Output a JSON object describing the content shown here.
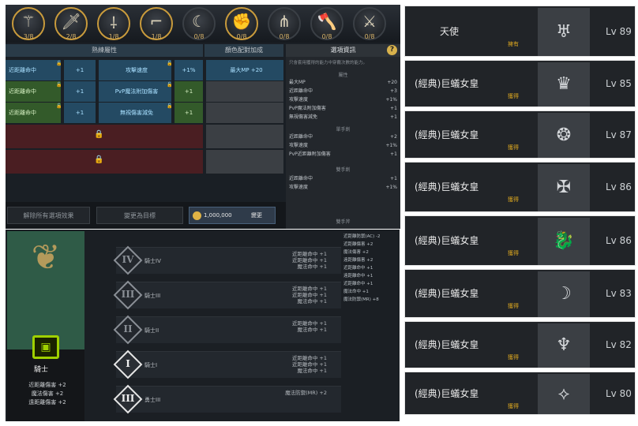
{
  "weapons": [
    {
      "icon": "staff-icon",
      "glyph": "⚚",
      "count": "3/8",
      "active": true
    },
    {
      "icon": "sword-icon",
      "glyph": "🗡",
      "count": "2/8",
      "active": true
    },
    {
      "icon": "spear-icon",
      "glyph": "⸸",
      "count": "1/8",
      "active": true
    },
    {
      "icon": "gun-icon",
      "glyph": "⌐",
      "count": "1/8",
      "active": true
    },
    {
      "icon": "scythe-icon",
      "glyph": "☾",
      "count": "0/8",
      "active": false
    },
    {
      "icon": "gauntlet-icon",
      "glyph": "✊",
      "count": "0/8",
      "active": true
    },
    {
      "icon": "claw-icon",
      "glyph": "⋔",
      "count": "0/8",
      "active": false
    },
    {
      "icon": "axe-icon",
      "glyph": "🪓",
      "count": "0/8",
      "active": false
    },
    {
      "icon": "dagger-icon",
      "glyph": "⚔",
      "count": "0/8",
      "active": false
    }
  ],
  "panelA": {
    "col_mastery": "熟練屬性",
    "col_color": "顏色配對加成",
    "col_select": "選項資訊",
    "rows": [
      {
        "a": "近距離命中",
        "av": "+1",
        "b": "攻擊速度",
        "bv": "+1%",
        "c": "最大MP +20"
      },
      {
        "a": "近距離命中",
        "av": "+1",
        "b": "PvP魔法附加傷害",
        "bv": "+1",
        "c": ""
      },
      {
        "a": "近距離命中",
        "av": "+1",
        "b": "無視傷害減免",
        "bv": "+1",
        "c": ""
      }
    ],
    "info_note": "只會套用獲得的能力中穿戴次數的能力。",
    "sec1": "屬性",
    "sec2": "單手劍",
    "sec3": "雙手劍",
    "info1": [
      [
        "最大MP",
        "+20"
      ],
      [
        "近距離命中",
        "+3"
      ],
      [
        "攻擊速度",
        "+1%"
      ],
      [
        "PvP魔法附加傷害",
        "+1"
      ],
      [
        "無視傷害減免",
        "+1"
      ]
    ],
    "info2": [
      [
        "近距離命中",
        "+2"
      ],
      [
        "攻擊速度",
        "+1%"
      ],
      [
        "PvP近距離附加傷害",
        "+1"
      ]
    ],
    "info3": [
      [
        "近距離命中",
        "+1"
      ],
      [
        "攻擊速度",
        "+1%"
      ]
    ],
    "info_last": "雙手斧",
    "btn_reset": "解除所有選項效果",
    "btn_change": "變更為目標",
    "gold": "1,000,000",
    "btn_confirm": "變更"
  },
  "panelB": {
    "class_name": "騎士",
    "class_stats": [
      "近距離傷害 +2",
      "魔法傷害 +2",
      "遠距離傷害 +2"
    ],
    "ranks": [
      {
        "roman": "IV",
        "label": "騎士IV",
        "stats": [
          "近距離命中 +1",
          "近距離命中 +1",
          "魔法命中 +1"
        ],
        "active": false
      },
      {
        "roman": "III",
        "label": "騎士III",
        "stats": [
          "近距離命中 +1",
          "近距離命中 +1",
          "魔法命中 +1"
        ],
        "active": false
      },
      {
        "roman": "II",
        "label": "騎士II",
        "stats": [
          "近距離命中 +1",
          "魔法命中 +1"
        ],
        "active": false
      },
      {
        "roman": "I",
        "label": "騎士I",
        "stats": [
          "近距離命中 +1",
          "近距離命中 +1",
          "魔法命中 +1"
        ],
        "active": true
      },
      {
        "roman": "III",
        "label": "勇士III",
        "stats": [
          "魔法防禦(MR) +2"
        ],
        "active": true
      }
    ],
    "summary": [
      "近距離防禦(AC) -2",
      "近距離傷害 +2",
      "魔法傷害 +2",
      "遠距離傷害 +2",
      "近距離命中 +1",
      "遠距離命中 +1",
      "近距離命中 +1",
      "魔法命中 +1",
      "魔法防禦(MR) +8"
    ]
  },
  "list": [
    {
      "name": "天使",
      "status": "擁有",
      "icon": "angel-icon",
      "glyph": "♅",
      "level": "Lv 89"
    },
    {
      "name": "(經典)巨蟻女皇",
      "status": "獲得",
      "icon": "spiky-crown-icon",
      "glyph": "♛",
      "level": "Lv 85"
    },
    {
      "name": "(經典)巨蟻女皇",
      "status": "獲得",
      "icon": "ornament-icon",
      "glyph": "❂",
      "level": "Lv 87"
    },
    {
      "name": "(經典)巨蟻女皇",
      "status": "獲得",
      "icon": "rune-icon",
      "glyph": "✠",
      "level": "Lv 86"
    },
    {
      "name": "(經典)巨蟻女皇",
      "status": "獲得",
      "icon": "dragon-icon",
      "glyph": "🐉",
      "level": "Lv 86"
    },
    {
      "name": "(經典)巨蟻女皇",
      "status": "獲得",
      "icon": "reaper-icon",
      "glyph": "☽",
      "level": "Lv 83"
    },
    {
      "name": "(經典)巨蟻女皇",
      "status": "獲得",
      "icon": "crystal-icon",
      "glyph": "♆",
      "level": "Lv 82"
    },
    {
      "name": "(經典)巨蟻女皇",
      "status": "獲得",
      "icon": "wing-icon",
      "glyph": "⟡",
      "level": "Lv 80"
    }
  ]
}
